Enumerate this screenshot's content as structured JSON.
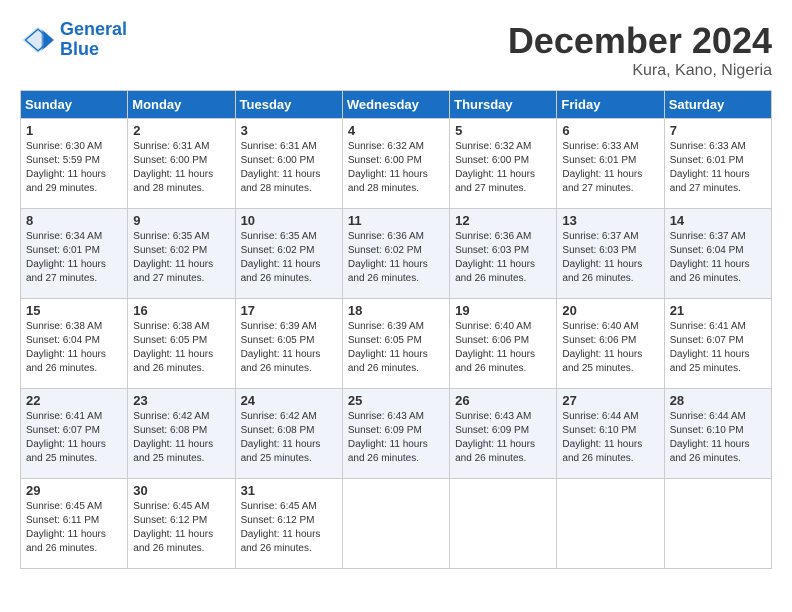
{
  "logo": {
    "line1": "General",
    "line2": "Blue"
  },
  "title": "December 2024",
  "subtitle": "Kura, Kano, Nigeria",
  "days_header": [
    "Sunday",
    "Monday",
    "Tuesday",
    "Wednesday",
    "Thursday",
    "Friday",
    "Saturday"
  ],
  "weeks": [
    [
      {
        "day": "1",
        "sunrise": "6:30 AM",
        "sunset": "5:59 PM",
        "daylight": "11 hours and 29 minutes."
      },
      {
        "day": "2",
        "sunrise": "6:31 AM",
        "sunset": "6:00 PM",
        "daylight": "11 hours and 28 minutes."
      },
      {
        "day": "3",
        "sunrise": "6:31 AM",
        "sunset": "6:00 PM",
        "daylight": "11 hours and 28 minutes."
      },
      {
        "day": "4",
        "sunrise": "6:32 AM",
        "sunset": "6:00 PM",
        "daylight": "11 hours and 28 minutes."
      },
      {
        "day": "5",
        "sunrise": "6:32 AM",
        "sunset": "6:00 PM",
        "daylight": "11 hours and 27 minutes."
      },
      {
        "day": "6",
        "sunrise": "6:33 AM",
        "sunset": "6:01 PM",
        "daylight": "11 hours and 27 minutes."
      },
      {
        "day": "7",
        "sunrise": "6:33 AM",
        "sunset": "6:01 PM",
        "daylight": "11 hours and 27 minutes."
      }
    ],
    [
      {
        "day": "8",
        "sunrise": "6:34 AM",
        "sunset": "6:01 PM",
        "daylight": "11 hours and 27 minutes."
      },
      {
        "day": "9",
        "sunrise": "6:35 AM",
        "sunset": "6:02 PM",
        "daylight": "11 hours and 27 minutes."
      },
      {
        "day": "10",
        "sunrise": "6:35 AM",
        "sunset": "6:02 PM",
        "daylight": "11 hours and 26 minutes."
      },
      {
        "day": "11",
        "sunrise": "6:36 AM",
        "sunset": "6:02 PM",
        "daylight": "11 hours and 26 minutes."
      },
      {
        "day": "12",
        "sunrise": "6:36 AM",
        "sunset": "6:03 PM",
        "daylight": "11 hours and 26 minutes."
      },
      {
        "day": "13",
        "sunrise": "6:37 AM",
        "sunset": "6:03 PM",
        "daylight": "11 hours and 26 minutes."
      },
      {
        "day": "14",
        "sunrise": "6:37 AM",
        "sunset": "6:04 PM",
        "daylight": "11 hours and 26 minutes."
      }
    ],
    [
      {
        "day": "15",
        "sunrise": "6:38 AM",
        "sunset": "6:04 PM",
        "daylight": "11 hours and 26 minutes."
      },
      {
        "day": "16",
        "sunrise": "6:38 AM",
        "sunset": "6:05 PM",
        "daylight": "11 hours and 26 minutes."
      },
      {
        "day": "17",
        "sunrise": "6:39 AM",
        "sunset": "6:05 PM",
        "daylight": "11 hours and 26 minutes."
      },
      {
        "day": "18",
        "sunrise": "6:39 AM",
        "sunset": "6:05 PM",
        "daylight": "11 hours and 26 minutes."
      },
      {
        "day": "19",
        "sunrise": "6:40 AM",
        "sunset": "6:06 PM",
        "daylight": "11 hours and 26 minutes."
      },
      {
        "day": "20",
        "sunrise": "6:40 AM",
        "sunset": "6:06 PM",
        "daylight": "11 hours and 25 minutes."
      },
      {
        "day": "21",
        "sunrise": "6:41 AM",
        "sunset": "6:07 PM",
        "daylight": "11 hours and 25 minutes."
      }
    ],
    [
      {
        "day": "22",
        "sunrise": "6:41 AM",
        "sunset": "6:07 PM",
        "daylight": "11 hours and 25 minutes."
      },
      {
        "day": "23",
        "sunrise": "6:42 AM",
        "sunset": "6:08 PM",
        "daylight": "11 hours and 25 minutes."
      },
      {
        "day": "24",
        "sunrise": "6:42 AM",
        "sunset": "6:08 PM",
        "daylight": "11 hours and 25 minutes."
      },
      {
        "day": "25",
        "sunrise": "6:43 AM",
        "sunset": "6:09 PM",
        "daylight": "11 hours and 26 minutes."
      },
      {
        "day": "26",
        "sunrise": "6:43 AM",
        "sunset": "6:09 PM",
        "daylight": "11 hours and 26 minutes."
      },
      {
        "day": "27",
        "sunrise": "6:44 AM",
        "sunset": "6:10 PM",
        "daylight": "11 hours and 26 minutes."
      },
      {
        "day": "28",
        "sunrise": "6:44 AM",
        "sunset": "6:10 PM",
        "daylight": "11 hours and 26 minutes."
      }
    ],
    [
      {
        "day": "29",
        "sunrise": "6:45 AM",
        "sunset": "6:11 PM",
        "daylight": "11 hours and 26 minutes."
      },
      {
        "day": "30",
        "sunrise": "6:45 AM",
        "sunset": "6:12 PM",
        "daylight": "11 hours and 26 minutes."
      },
      {
        "day": "31",
        "sunrise": "6:45 AM",
        "sunset": "6:12 PM",
        "daylight": "11 hours and 26 minutes."
      },
      null,
      null,
      null,
      null
    ]
  ]
}
